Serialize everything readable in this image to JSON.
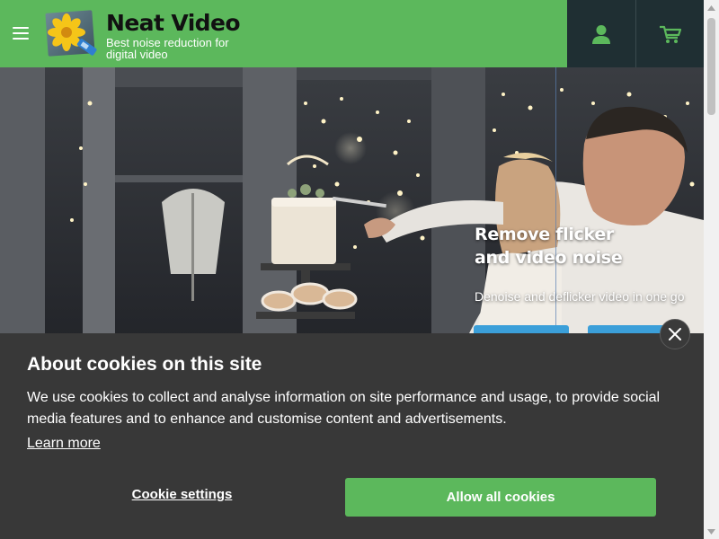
{
  "header": {
    "brand_name": "Neat Video",
    "tagline": "Best noise reduction for digital video",
    "menu_icon": "hamburger-menu-icon",
    "account_icon": "user-icon",
    "cart_icon": "shopping-cart-icon",
    "colors": {
      "green": "#5cb85c",
      "dark": "#1f2f33",
      "icon_green": "#5cb85c"
    }
  },
  "hero": {
    "title_line1": "Remove flicker",
    "title_line2": "and video noise",
    "subtitle": "Denoise and deflicker video in one go",
    "button_color": "#3b9fd9"
  },
  "cookie_banner": {
    "title": "About cookies on this site",
    "text": "We use cookies to collect and analyse information on site performance and usage, to provide social media features and to enhance and customise content and advertisements.",
    "learn_more": "Learn more",
    "settings_label": "Cookie settings",
    "allow_label": "Allow all cookies",
    "close_icon": "close-icon",
    "colors": {
      "background": "#383838",
      "allow_button": "#5cb85c"
    }
  }
}
